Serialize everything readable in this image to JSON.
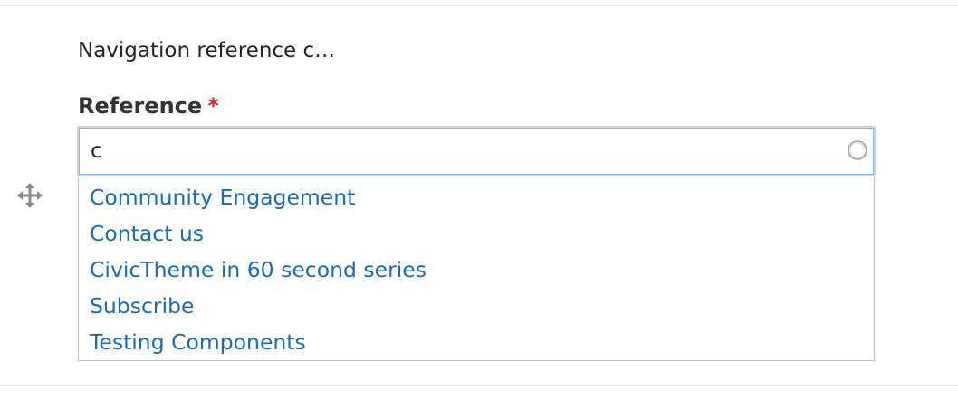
{
  "summary_text": "Navigation reference c…",
  "reference_field": {
    "label": "Reference",
    "required_marker": "*",
    "value": "c"
  },
  "autocomplete": {
    "suggestions": [
      "Community Engagement",
      "Contact us",
      "CivicTheme in 60 second series",
      "Subscribe",
      "Testing Components"
    ]
  },
  "icons": {
    "drag_handle": "move-arrows-icon",
    "throbber": "loading-circle-icon"
  },
  "colors": {
    "link": "#1a6ab4",
    "required": "#dc2323",
    "input_focus_border": "#bcd8ee",
    "divider": "#e6e6e6"
  }
}
